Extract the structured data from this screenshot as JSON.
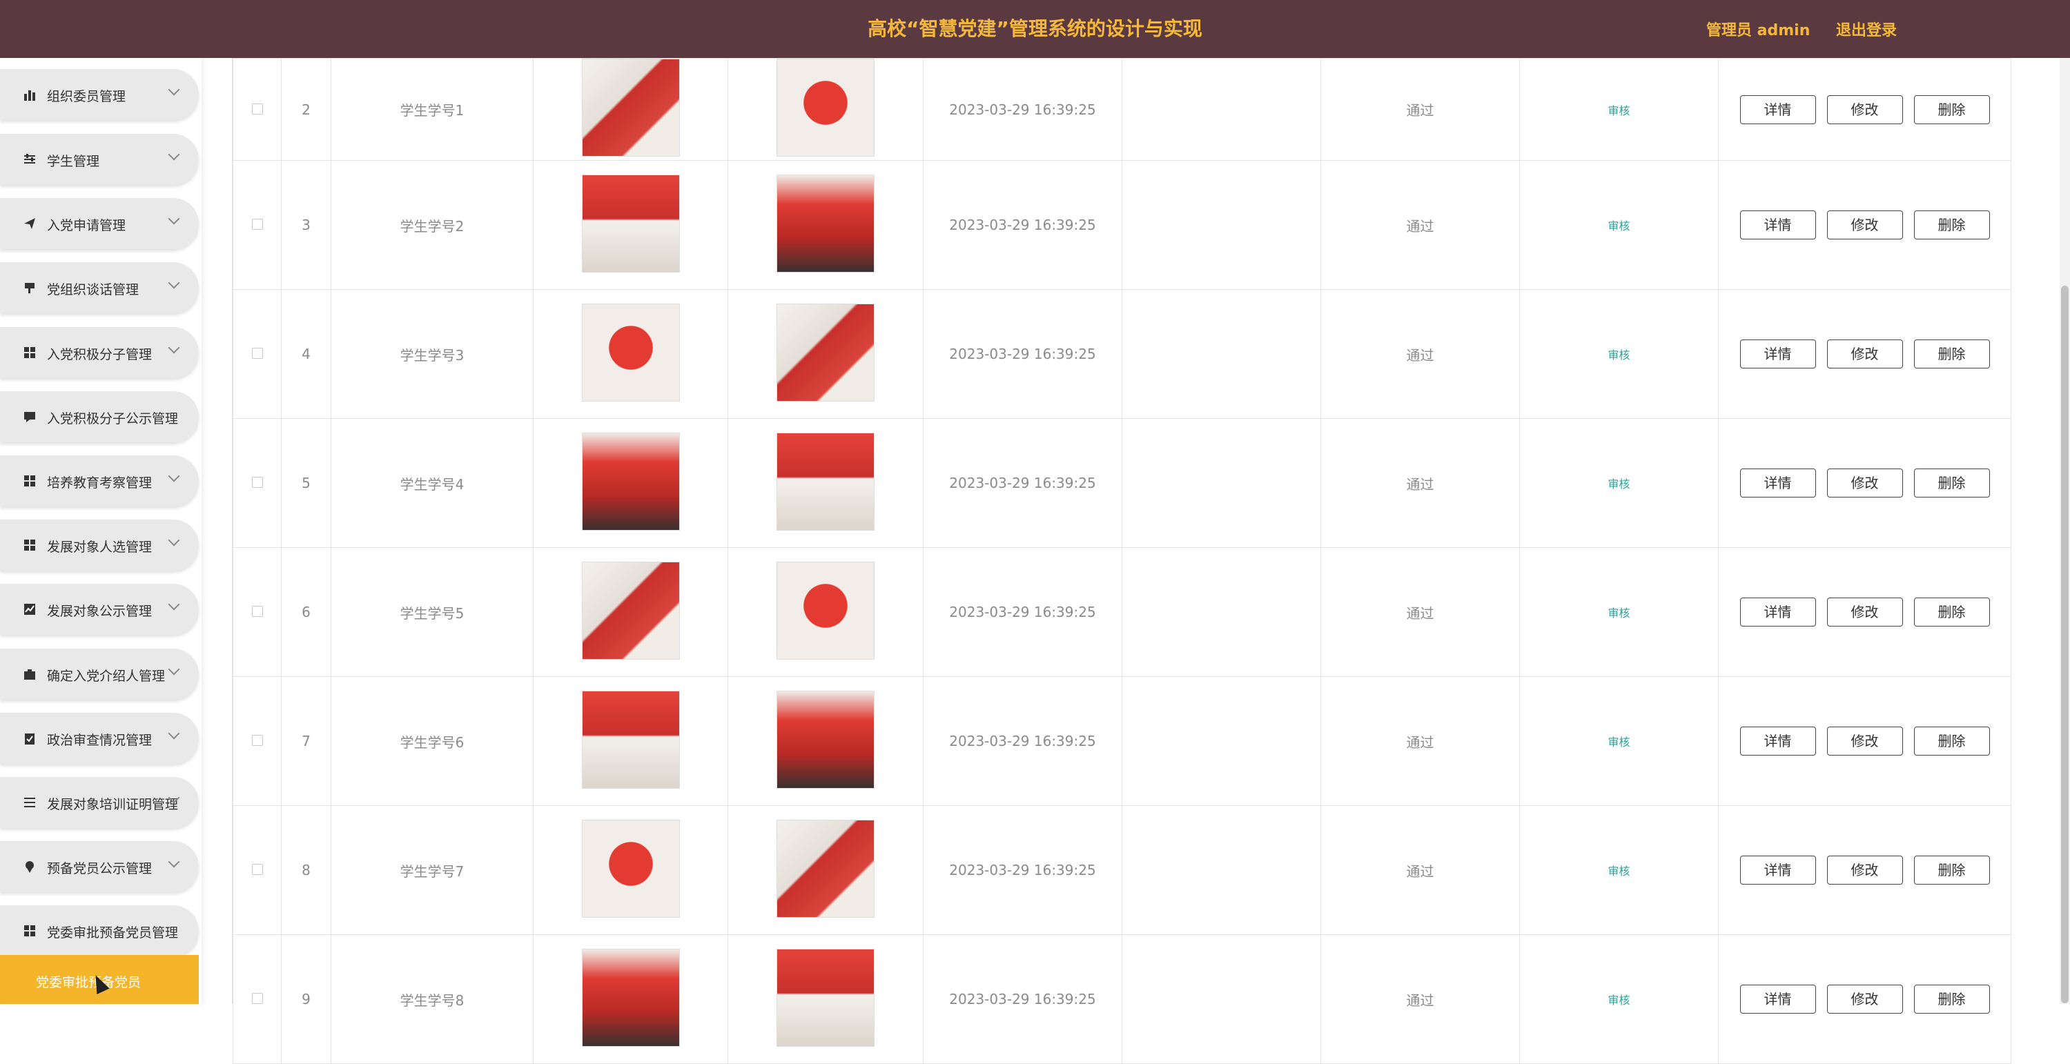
{
  "header": {
    "title": "高校“智慧党建”管理系统的设计与实现",
    "user_label": "管理员 admin",
    "logout_label": "退出登录"
  },
  "colors": {
    "header_bg": "#5a3a40",
    "accent": "#f5b52b",
    "audit_link": "#2aa39a"
  },
  "sidebar": {
    "items": [
      {
        "label": "组织委员管理",
        "icon": "bar-chart-icon"
      },
      {
        "label": "学生管理",
        "icon": "sliders-icon"
      },
      {
        "label": "入党申请管理",
        "icon": "send-icon"
      },
      {
        "label": "党组织谈话管理",
        "icon": "flag-icon"
      },
      {
        "label": "入党积极分子管理",
        "icon": "grid-icon"
      },
      {
        "label": "入党积极分子公示管理",
        "icon": "chat-icon"
      },
      {
        "label": "培养教育考察管理",
        "icon": "grid-icon"
      },
      {
        "label": "发展对象人选管理",
        "icon": "grid-icon"
      },
      {
        "label": "发展对象公示管理",
        "icon": "line-chart-icon"
      },
      {
        "label": "确定入党介绍人管理",
        "icon": "briefcase-icon"
      },
      {
        "label": "政治审查情况管理",
        "icon": "clipboard-icon"
      },
      {
        "label": "发展对象培训证明管理",
        "icon": "list-icon"
      },
      {
        "label": "预备党员公示管理",
        "icon": "pin-icon"
      },
      {
        "label": "党委审批预备党员管理",
        "icon": "grid-icon"
      }
    ],
    "active_item": {
      "label": "党委审批预备党员"
    }
  },
  "table": {
    "rows": [
      {
        "index": "2",
        "student_id": "学生学号1",
        "time": "2023-03-29 16:39:25",
        "status": "通过",
        "audit": "审核"
      },
      {
        "index": "3",
        "student_id": "学生学号2",
        "time": "2023-03-29 16:39:25",
        "status": "通过",
        "audit": "审核"
      },
      {
        "index": "4",
        "student_id": "学生学号3",
        "time": "2023-03-29 16:39:25",
        "status": "通过",
        "audit": "审核"
      },
      {
        "index": "5",
        "student_id": "学生学号4",
        "time": "2023-03-29 16:39:25",
        "status": "通过",
        "audit": "审核"
      },
      {
        "index": "6",
        "student_id": "学生学号5",
        "time": "2023-03-29 16:39:25",
        "status": "通过",
        "audit": "审核"
      },
      {
        "index": "7",
        "student_id": "学生学号6",
        "time": "2023-03-29 16:39:25",
        "status": "通过",
        "audit": "审核"
      },
      {
        "index": "8",
        "student_id": "学生学号7",
        "time": "2023-03-29 16:39:25",
        "status": "通过",
        "audit": "审核"
      },
      {
        "index": "9",
        "student_id": "学生学号8",
        "time": "2023-03-29 16:39:25",
        "status": "通过",
        "audit": "审核"
      }
    ],
    "actions": {
      "detail": "详情",
      "edit": "修改",
      "delete": "删除"
    }
  }
}
